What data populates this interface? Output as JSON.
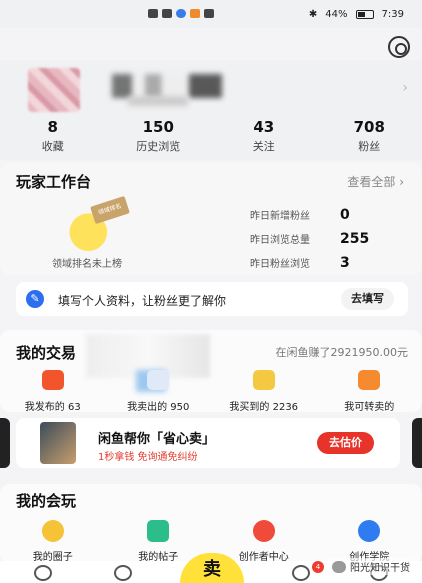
{
  "status_bar": {
    "battery": "44%",
    "time": "7:39"
  },
  "profile": {
    "stats": [
      {
        "value": "8",
        "label": "收藏"
      },
      {
        "value": "150",
        "label": "历史浏览"
      },
      {
        "value": "43",
        "label": "关注"
      },
      {
        "value": "708",
        "label": "粉丝"
      }
    ]
  },
  "workbench": {
    "title": "玩家工作台",
    "view_all": "查看全部 ›",
    "badge_text": "领域排名",
    "rank_note": "领域排名未上榜",
    "rows": [
      {
        "label": "昨日新增粉丝",
        "value": "0"
      },
      {
        "label": "昨日浏览总量",
        "value": "255"
      },
      {
        "label": "昨日粉丝浏览",
        "value": "3"
      }
    ]
  },
  "info_banner": {
    "text": "填写个人资料，让粉丝更了解你",
    "button": "去填写"
  },
  "trade": {
    "title": "我的交易",
    "earn_note": "在闲鱼赚了2921950.00元",
    "items": [
      {
        "label": "我发布的 63",
        "icon": "tag-icon"
      },
      {
        "label": "我卖出的 950",
        "icon": "sold-icon"
      },
      {
        "label": "我买到的 2236",
        "icon": "bought-icon"
      },
      {
        "label": "我可转卖的",
        "icon": "resell-icon"
      }
    ]
  },
  "promo": {
    "title": "闲鱼帮你「省心卖」",
    "subtitle": "1秒拿钱 免询通免纠纷",
    "button": "去估价"
  },
  "fun": {
    "title": "我的会玩",
    "items": [
      {
        "label": "我的圈子",
        "icon": "circle-icon"
      },
      {
        "label": "我的帖子",
        "icon": "post-icon"
      },
      {
        "label": "创作者中心",
        "icon": "creator-icon"
      },
      {
        "label": "创作学院",
        "icon": "academy-icon"
      }
    ]
  },
  "tabbar": {
    "sell_label": "卖",
    "message_badge": "4"
  },
  "watermark": "阳光知识干货"
}
